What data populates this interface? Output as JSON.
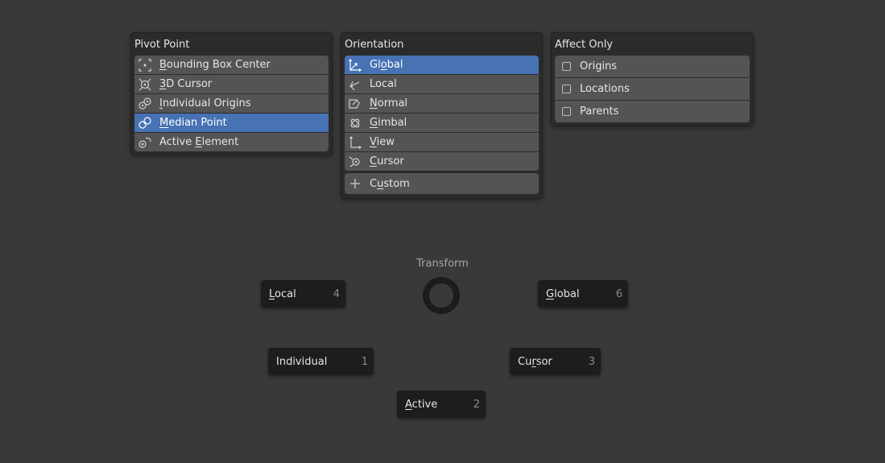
{
  "pivot": {
    "title": "Pivot Point",
    "items": [
      {
        "pre": "",
        "u": "B",
        "post": "ounding Box Center",
        "icon": "bounding-box-center-icon",
        "selected": false
      },
      {
        "pre": "",
        "u": "3",
        "post": "D Cursor",
        "icon": "3d-cursor-icon",
        "selected": false
      },
      {
        "pre": "",
        "u": "I",
        "post": "ndividual Origins",
        "icon": "individual-origins-icon",
        "selected": false
      },
      {
        "pre": "",
        "u": "M",
        "post": "edian Point",
        "icon": "median-point-icon",
        "selected": true
      },
      {
        "pre": "Active ",
        "u": "E",
        "post": "lement",
        "icon": "active-element-icon",
        "selected": false
      }
    ]
  },
  "orientation": {
    "title": "Orientation",
    "items": [
      {
        "pre": "Gl",
        "u": "o",
        "post": "bal",
        "icon": "global-orientation-icon",
        "selected": true
      },
      {
        "pre": "",
        "u": "",
        "post": "Local",
        "icon": "local-orientation-icon",
        "selected": false
      },
      {
        "pre": "",
        "u": "N",
        "post": "ormal",
        "icon": "normal-orientation-icon",
        "selected": false
      },
      {
        "pre": "",
        "u": "G",
        "post": "imbal",
        "icon": "gimbal-orientation-icon",
        "selected": false
      },
      {
        "pre": "",
        "u": "V",
        "post": "iew",
        "icon": "view-orientation-icon",
        "selected": false
      },
      {
        "pre": "",
        "u": "C",
        "post": "ursor",
        "icon": "cursor-orientation-icon",
        "selected": false
      }
    ],
    "custom": {
      "pre": "C",
      "u": "u",
      "post": "stom",
      "icon": "plus-icon"
    }
  },
  "affect": {
    "title": "Affect Only",
    "items": [
      {
        "label": "Origins",
        "checked": false
      },
      {
        "label": "Locations",
        "checked": false
      },
      {
        "label": "Parents",
        "checked": false
      }
    ]
  },
  "pie": {
    "title": "Transform",
    "buttons": [
      {
        "pre": "",
        "u": "L",
        "post": "ocal",
        "key": "4"
      },
      {
        "pre": "",
        "u": "G",
        "post": "lobal",
        "key": "6"
      },
      {
        "pre": "",
        "u": "",
        "post": "Individual",
        "key": "1"
      },
      {
        "pre": "Cu",
        "u": "r",
        "post": "sor",
        "key": "3"
      },
      {
        "pre": "",
        "u": "A",
        "post": "ctive",
        "key": "2"
      }
    ]
  },
  "colors": {
    "background": "#393939",
    "selected": "#4772b3",
    "row": "#545454",
    "panel": "#2b2b2b",
    "pie_button": "#1d1d1d"
  }
}
